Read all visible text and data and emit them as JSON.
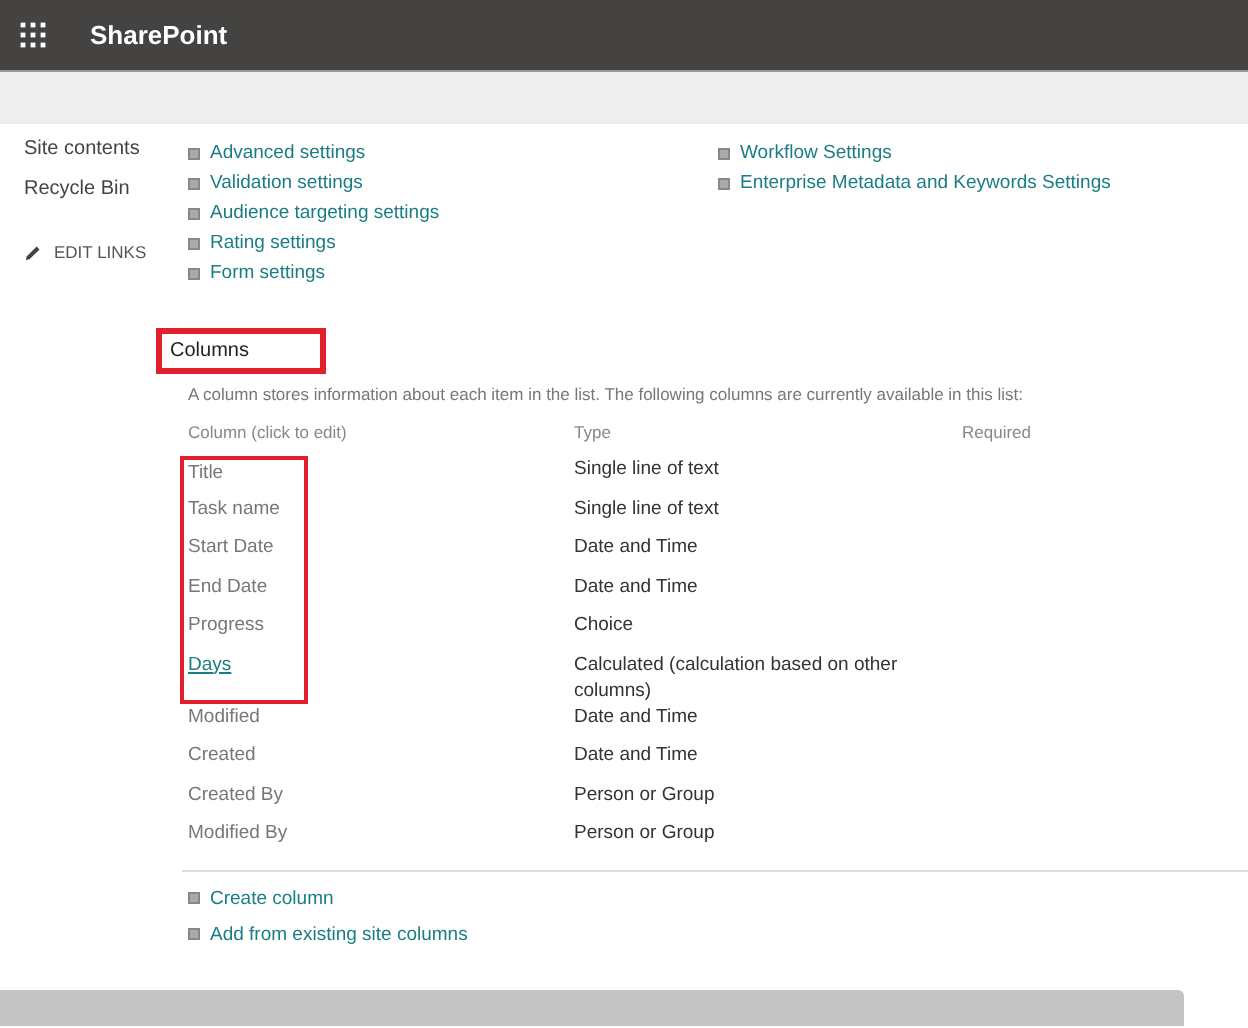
{
  "header": {
    "app_title": "SharePoint"
  },
  "sidebar": {
    "items": [
      "Site contents",
      "Recycle Bin"
    ],
    "edit_links": "EDIT LINKS"
  },
  "settings": {
    "left": [
      "Advanced settings",
      "Validation settings",
      "Audience targeting settings",
      "Rating settings",
      "Form settings"
    ],
    "right": [
      "Workflow Settings",
      "Enterprise Metadata and Keywords Settings"
    ]
  },
  "columns_section": {
    "heading": "Columns",
    "heading_highlighted": true,
    "description": "A column stores information about each item in the list. The following columns are currently available in this list:",
    "table": {
      "columns": [
        "Column (click to edit)",
        "Type",
        "Required"
      ],
      "rows": [
        {
          "name": "Title",
          "type": "Single line of text",
          "kind": "text",
          "highlighted": true
        },
        {
          "name": "Task name",
          "type": "Single line of text",
          "kind": "text",
          "highlighted": true
        },
        {
          "name": "Start Date",
          "type": "Date and Time",
          "kind": "text",
          "highlighted": true
        },
        {
          "name": "End Date",
          "type": "Date and Time",
          "kind": "text",
          "highlighted": true
        },
        {
          "name": "Progress",
          "type": "Choice",
          "kind": "text",
          "highlighted": true
        },
        {
          "name": "Days",
          "type": "Calculated (calculation based on other columns)",
          "kind": "link",
          "highlighted": true
        },
        {
          "name": "Modified",
          "type": "Date and Time",
          "kind": "text",
          "highlighted": false
        },
        {
          "name": "Created",
          "type": "Date and Time",
          "kind": "text",
          "highlighted": false
        },
        {
          "name": "Created By",
          "type": "Person or Group",
          "kind": "text",
          "highlighted": false
        },
        {
          "name": "Modified By",
          "type": "Person or Group",
          "kind": "text",
          "highlighted": false
        }
      ]
    },
    "actions": [
      "Create column",
      "Add from existing site columns"
    ]
  }
}
